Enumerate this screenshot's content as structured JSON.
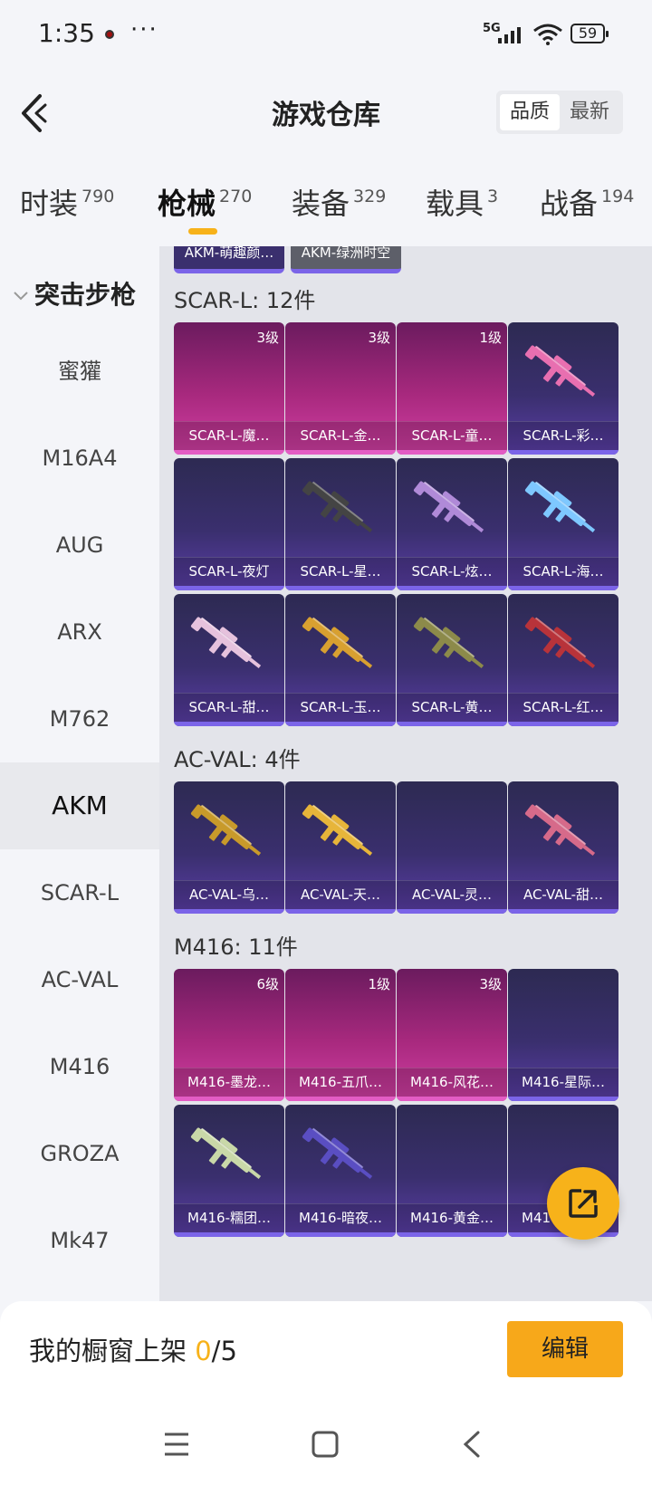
{
  "status_bar": {
    "time": "1:35",
    "more": "···",
    "network": "5G",
    "battery": "59"
  },
  "header": {
    "title": "游戏仓库",
    "sort_options": [
      "品质",
      "最新"
    ]
  },
  "categories": [
    {
      "label": "时装",
      "count": "790"
    },
    {
      "label": "枪械",
      "count": "270",
      "active": true
    },
    {
      "label": "装备",
      "count": "329"
    },
    {
      "label": "载具",
      "count": "3"
    },
    {
      "label": "战备",
      "count": "194"
    }
  ],
  "sidebar": {
    "group": "突击步枪",
    "items": [
      "蜜獾",
      "M16A4",
      "AUG",
      "ARX",
      "M762",
      "AKM",
      "SCAR-L",
      "AC-VAL",
      "M416",
      "GROZA",
      "Mk47"
    ],
    "active_item": "AKM"
  },
  "partial_top": [
    "AKM-萌趣颜…",
    "AKM-绿洲时空"
  ],
  "sections": [
    {
      "title": "SCAR-L: 12件",
      "items": [
        {
          "name": "SCAR-L-魔…",
          "level": "3级",
          "tier": "pink"
        },
        {
          "name": "SCAR-L-金…",
          "level": "3级",
          "tier": "pink"
        },
        {
          "name": "SCAR-L-童…",
          "level": "1级",
          "tier": "pink"
        },
        {
          "name": "SCAR-L-彩…",
          "tier": "purple",
          "gun": "#e86fb0"
        },
        {
          "name": "SCAR-L-夜灯",
          "tier": "purple"
        },
        {
          "name": "SCAR-L-星…",
          "tier": "purple",
          "gun": "#444"
        },
        {
          "name": "SCAR-L-炫…",
          "tier": "purple",
          "gun": "#b08ad8"
        },
        {
          "name": "SCAR-L-海…",
          "tier": "purple",
          "gun": "#7ec8ff"
        },
        {
          "name": "SCAR-L-甜…",
          "tier": "purple",
          "gun": "#e6c2dd"
        },
        {
          "name": "SCAR-L-玉…",
          "tier": "purple",
          "gun": "#d8a030"
        },
        {
          "name": "SCAR-L-黄…",
          "tier": "purple",
          "gun": "#8c8a4a"
        },
        {
          "name": "SCAR-L-红…",
          "tier": "purple",
          "gun": "#b8333a"
        }
      ]
    },
    {
      "title": "AC-VAL: 4件",
      "items": [
        {
          "name": "AC-VAL-乌…",
          "tier": "purple",
          "gun": "#c89a2a"
        },
        {
          "name": "AC-VAL-天…",
          "tier": "purple",
          "gun": "#e7b53a"
        },
        {
          "name": "AC-VAL-灵…",
          "tier": "purple"
        },
        {
          "name": "AC-VAL-甜…",
          "tier": "purple",
          "gun": "#d66a8a"
        }
      ]
    },
    {
      "title": "M416: 11件",
      "items": [
        {
          "name": "M416-墨龙…",
          "level": "6级",
          "tier": "pink"
        },
        {
          "name": "M416-五爪…",
          "level": "1级",
          "tier": "pink"
        },
        {
          "name": "M416-风花…",
          "level": "3级",
          "tier": "pink"
        },
        {
          "name": "M416-星际…",
          "tier": "purple"
        },
        {
          "name": "M416-糯团…",
          "tier": "purple",
          "gun": "#c9d8a8"
        },
        {
          "name": "M416-暗夜…",
          "tier": "purple",
          "gun": "#5a4ec2"
        },
        {
          "name": "M416-黄金…",
          "tier": "purple"
        },
        {
          "name": "M416-圣诞…",
          "tier": "purple"
        }
      ]
    }
  ],
  "showcase": {
    "label": "我的橱窗上架 ",
    "current": "0",
    "total": "/5"
  },
  "edit_button": "编辑",
  "colors": {
    "accent": "#f7b21a",
    "pink_tier": "#d23fa4",
    "purple_tier": "#5b3ea8"
  }
}
